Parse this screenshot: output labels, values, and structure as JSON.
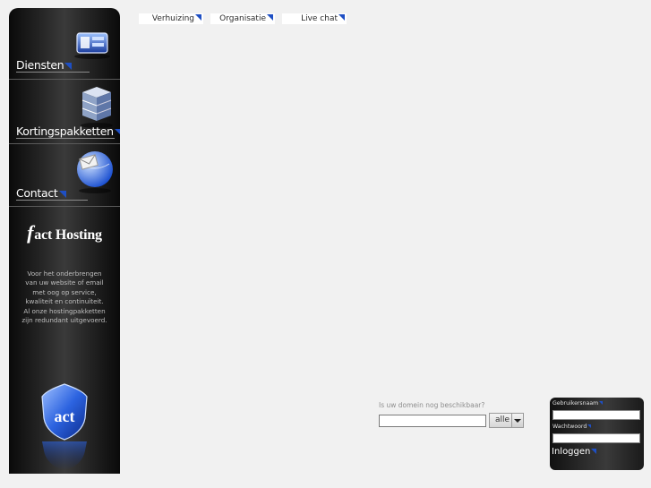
{
  "sidebar": {
    "nav": [
      {
        "label": "Diensten"
      },
      {
        "label": "Kortingspakketten"
      },
      {
        "label": "Contact"
      }
    ],
    "brand": {
      "logo_initial": "f",
      "logo_text": "act Hosting"
    },
    "description": "Voor het onderbrengen van uw website of email met oog op service, kwaliteit en continuïteit. Al onze hostingpakketten zijn redundant uitgevoerd.",
    "shield_text": "act"
  },
  "top_links": [
    {
      "label": "Verhuizing"
    },
    {
      "label": "Organisatie"
    },
    {
      "label": "Live chat"
    }
  ],
  "domain_check": {
    "label": "Is uw domein nog beschikbaar?",
    "input_value": "",
    "extension_selected": "alle"
  },
  "login": {
    "username_label": "Gebruikersnaam",
    "password_label": "Wachtwoord",
    "submit_label": "Inloggen"
  },
  "colors": {
    "accent": "#1e4fc4",
    "sidebar_bg": "#1c1c1c",
    "page_bg": "#f1f1f1"
  }
}
